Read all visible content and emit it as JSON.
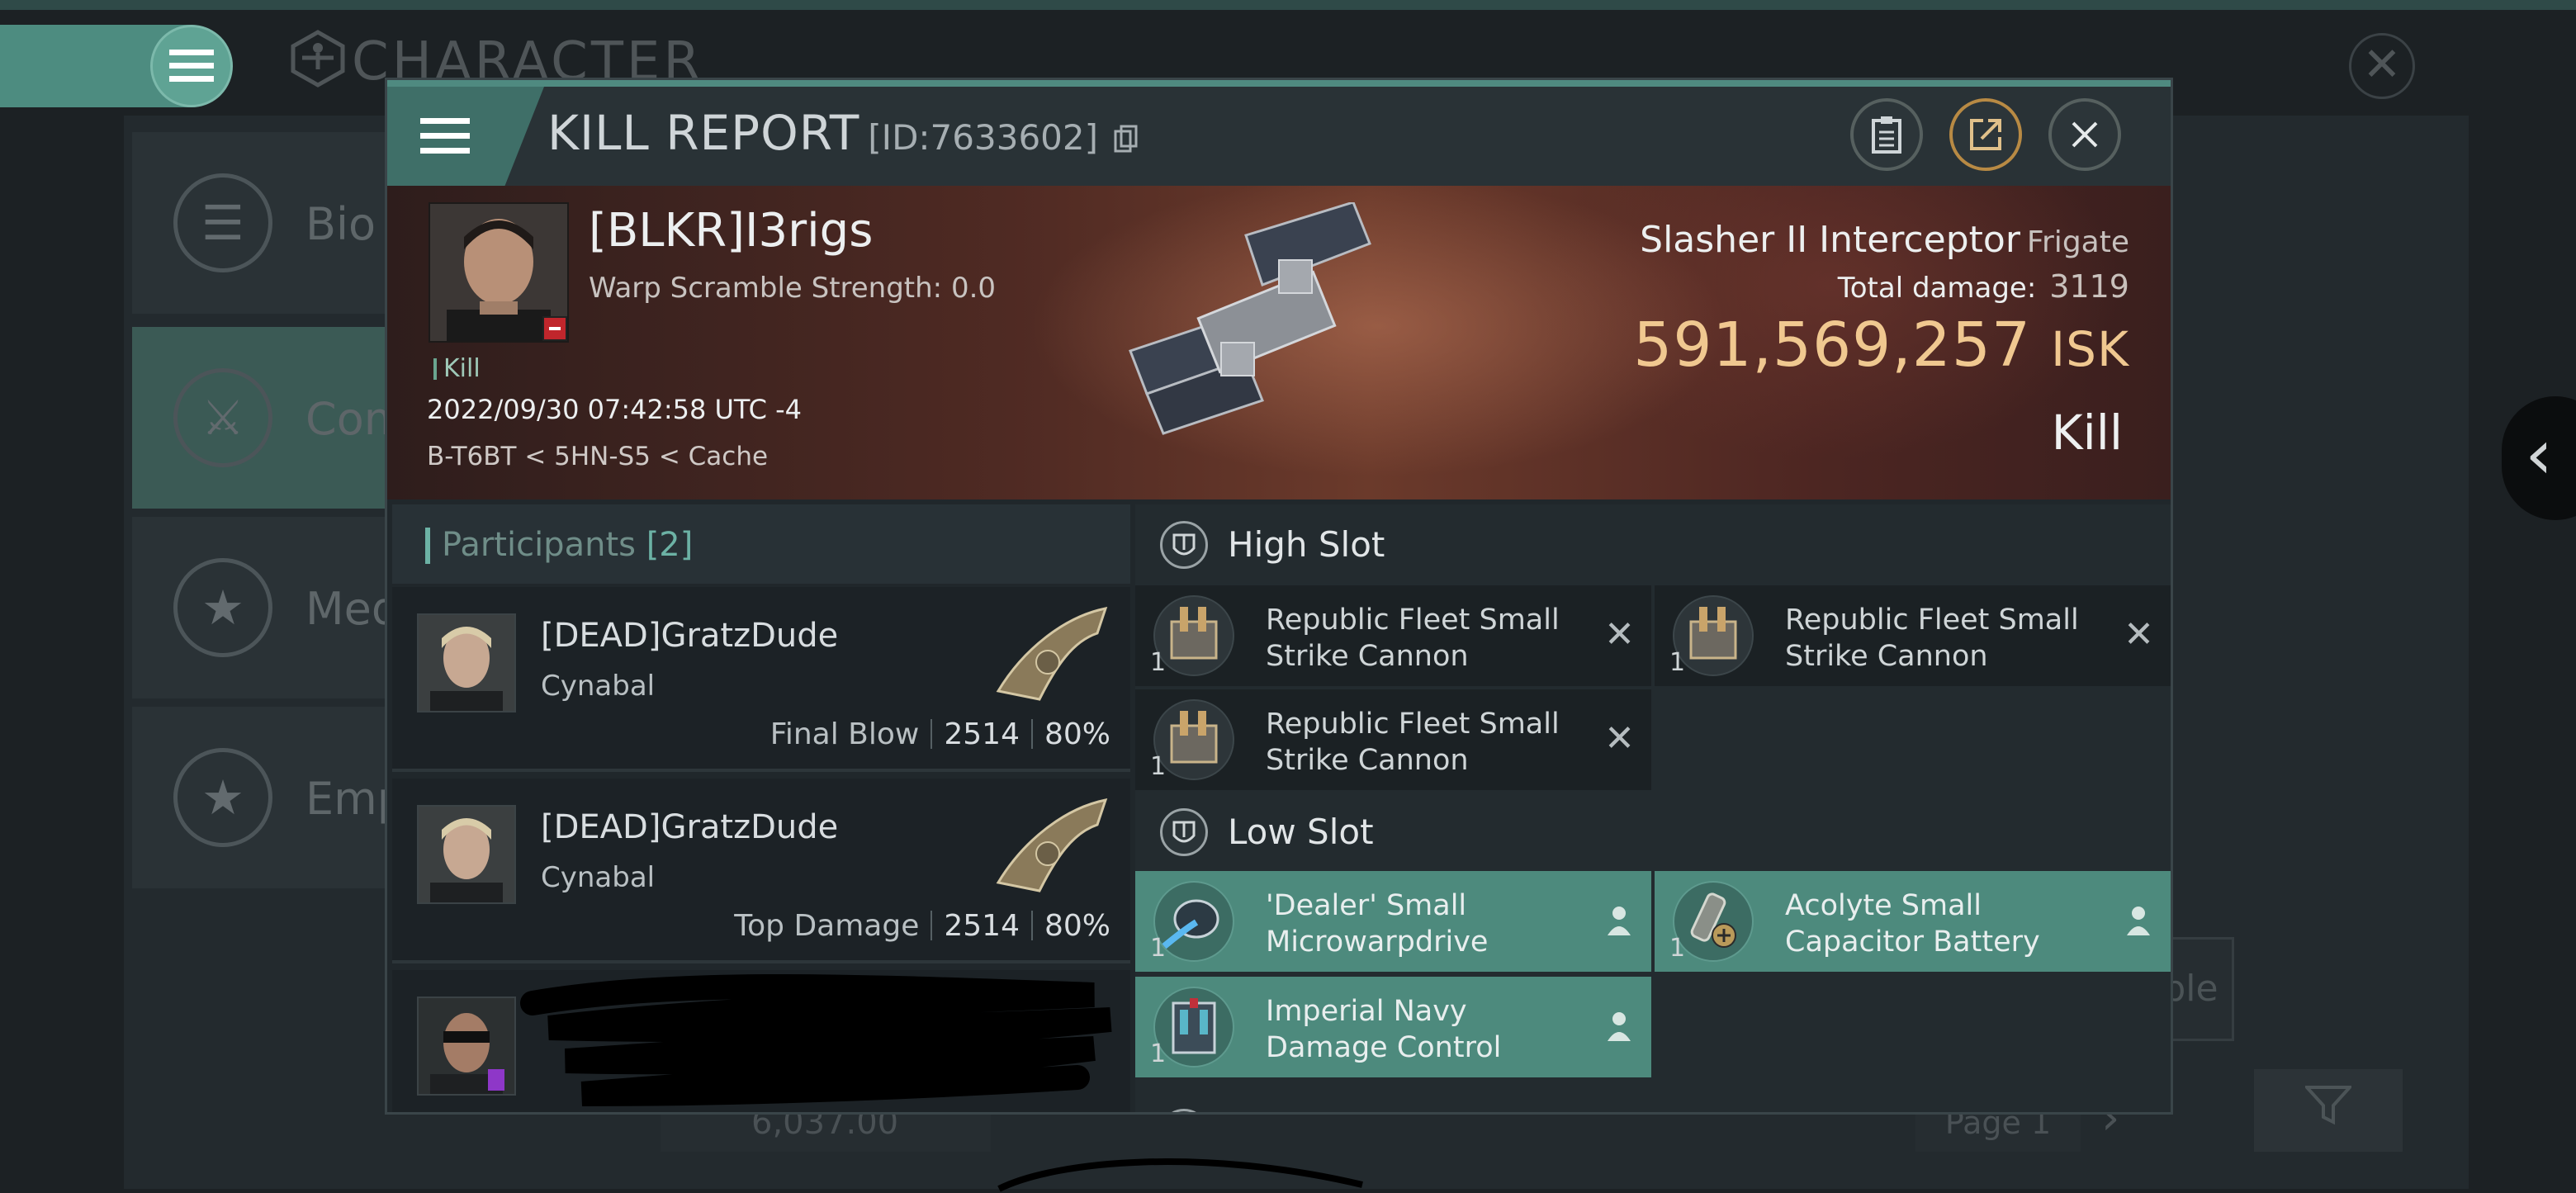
{
  "background": {
    "title": "CHARACTER",
    "sidebar": [
      {
        "label": "Bio",
        "icon": "menu-lines-icon",
        "active": false
      },
      {
        "label": "Com",
        "icon": "crossed-swords-icon",
        "active": true
      },
      {
        "label": "Med",
        "icon": "star-badge-icon",
        "active": false
      },
      {
        "label": "Emp",
        "icon": "star-wreath-icon",
        "active": false
      }
    ],
    "ghost_value": "6,037.00",
    "page_label": "Page 1",
    "ghost_btn_fragment": "ble"
  },
  "kill_report": {
    "title": "KILL REPORT",
    "id": "[ID:7633602]",
    "victim": {
      "name": "[BLKR]I3rigs",
      "warp_scramble": "Warp Scramble Strength: 0.0",
      "kill_tag": "Kill",
      "datetime": "2022/09/30 07:42:58 UTC -4",
      "location": "B-T6BT < 5HN-S5 < Cache"
    },
    "ship": {
      "name": "Slasher II Interceptor",
      "class": "Frigate",
      "total_damage_label": "Total damage:",
      "total_damage": "3119",
      "isk_value": "591,569,257",
      "isk_unit": "ISK",
      "report_type": "Kill"
    },
    "participants": {
      "title": "Participants",
      "count": "[2]",
      "rows": [
        {
          "name": "[DEAD]GratzDude",
          "ship": "Cynabal",
          "role": "Final Blow",
          "damage": "2514",
          "percent": "80%"
        },
        {
          "name": "[DEAD]GratzDude",
          "ship": "Cynabal",
          "role": "Top Damage",
          "damage": "2514",
          "percent": "80%"
        }
      ]
    },
    "fitting": {
      "high_slot": {
        "label": "High Slot",
        "modules": [
          {
            "name": "Republic Fleet Small Strike Cannon",
            "qty": "1"
          },
          {
            "name": "Republic Fleet Small Strike Cannon",
            "qty": "1"
          },
          {
            "name": "Republic Fleet Small Strike Cannon",
            "qty": "1"
          }
        ]
      },
      "low_slot": {
        "label": "Low Slot",
        "modules": [
          {
            "name": "'Dealer' Small Microwarpdrive",
            "qty": "1"
          },
          {
            "name": "Acolyte Small Capacitor Battery",
            "qty": "1"
          },
          {
            "name": "Imperial Navy Damage Control",
            "qty": "1"
          }
        ]
      }
    }
  },
  "colors": {
    "accent": "#4d8a7d",
    "isk": "#f0c890",
    "banner": "#6b3a2b"
  }
}
